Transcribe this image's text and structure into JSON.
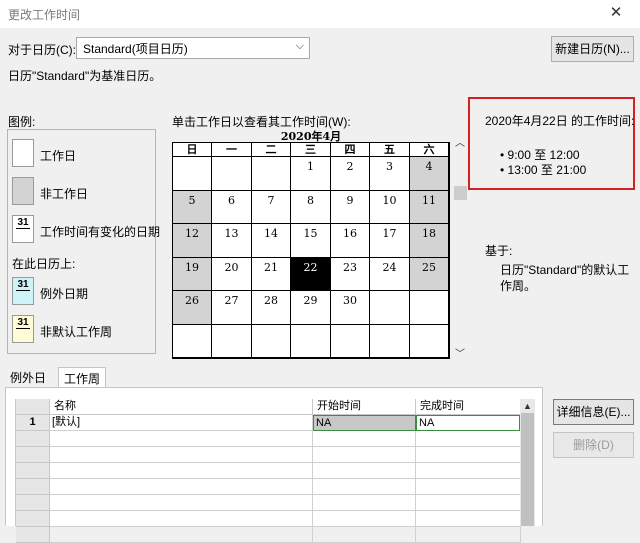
{
  "window": {
    "title": "更改工作时间",
    "close_label": "✕"
  },
  "calendar_select": {
    "label": "对于日历(C):",
    "value": "Standard(项目日历)"
  },
  "new_calendar_button": "新建日历(N)...",
  "base_note": "日历\"Standard\"为基准日历。",
  "legend": {
    "title": "图例:",
    "working_day": "工作日",
    "nonworking_day": "非工作日",
    "changed_day_num": "31",
    "changed_day": "工作时间有变化的日期",
    "on_this_calendar": "在此日历上:",
    "exception_num": "31",
    "exception_day": "例外日期",
    "nondefault_num": "31",
    "nondefault_week": "非默认工作周",
    "colors": {
      "exception": "#cdf2f7",
      "nondefault": "#fffbd6",
      "nonworking": "#d3d3d3"
    }
  },
  "calendar": {
    "instruction": "单击工作日以查看其工作时间(W):",
    "month_title": "2020年4月",
    "weekdays": [
      "日",
      "一",
      "二",
      "三",
      "四",
      "五",
      "六"
    ],
    "weeks": [
      [
        {
          "d": "",
          "n": false
        },
        {
          "d": "",
          "n": false
        },
        {
          "d": "",
          "n": false
        },
        {
          "d": "1",
          "n": false
        },
        {
          "d": "2",
          "n": false
        },
        {
          "d": "3",
          "n": false
        },
        {
          "d": "4",
          "n": true
        }
      ],
      [
        {
          "d": "5",
          "n": true
        },
        {
          "d": "6",
          "n": false
        },
        {
          "d": "7",
          "n": false
        },
        {
          "d": "8",
          "n": false
        },
        {
          "d": "9",
          "n": false
        },
        {
          "d": "10",
          "n": false
        },
        {
          "d": "11",
          "n": true
        }
      ],
      [
        {
          "d": "12",
          "n": true
        },
        {
          "d": "13",
          "n": false
        },
        {
          "d": "14",
          "n": false
        },
        {
          "d": "15",
          "n": false
        },
        {
          "d": "16",
          "n": false
        },
        {
          "d": "17",
          "n": false
        },
        {
          "d": "18",
          "n": true
        }
      ],
      [
        {
          "d": "19",
          "n": true
        },
        {
          "d": "20",
          "n": false
        },
        {
          "d": "21",
          "n": false
        },
        {
          "d": "22",
          "n": false,
          "sel": true
        },
        {
          "d": "23",
          "n": false
        },
        {
          "d": "24",
          "n": false
        },
        {
          "d": "25",
          "n": true
        }
      ],
      [
        {
          "d": "26",
          "n": true
        },
        {
          "d": "27",
          "n": false
        },
        {
          "d": "28",
          "n": false
        },
        {
          "d": "29",
          "n": false
        },
        {
          "d": "30",
          "n": false
        },
        {
          "d": "",
          "n": false
        },
        {
          "d": "",
          "n": false
        }
      ],
      [
        {
          "d": "",
          "n": false
        },
        {
          "d": "",
          "n": false
        },
        {
          "d": "",
          "n": false
        },
        {
          "d": "",
          "n": false
        },
        {
          "d": "",
          "n": false
        },
        {
          "d": "",
          "n": false
        },
        {
          "d": "",
          "n": false
        }
      ]
    ]
  },
  "work_time_info": {
    "title": "2020年4月22日 的工作时间:",
    "slots": [
      "• 9:00 至 12:00",
      "• 13:00 至 21:00"
    ],
    "based_on_label": "基于:",
    "based_on_text": "日历\"Standard\"的默认工作周。"
  },
  "tabs": [
    {
      "label": "例外日期",
      "active": false
    },
    {
      "label": "工作周",
      "active": true
    }
  ],
  "table": {
    "headers": [
      "名称",
      "开始时间",
      "完成时间"
    ],
    "rows": [
      {
        "num": "1",
        "name": "[默认]",
        "start": "NA",
        "finish": "NA"
      }
    ],
    "empty_rows": 7
  },
  "detail_button": "详细信息(E)...",
  "delete_button": "删除(D)"
}
